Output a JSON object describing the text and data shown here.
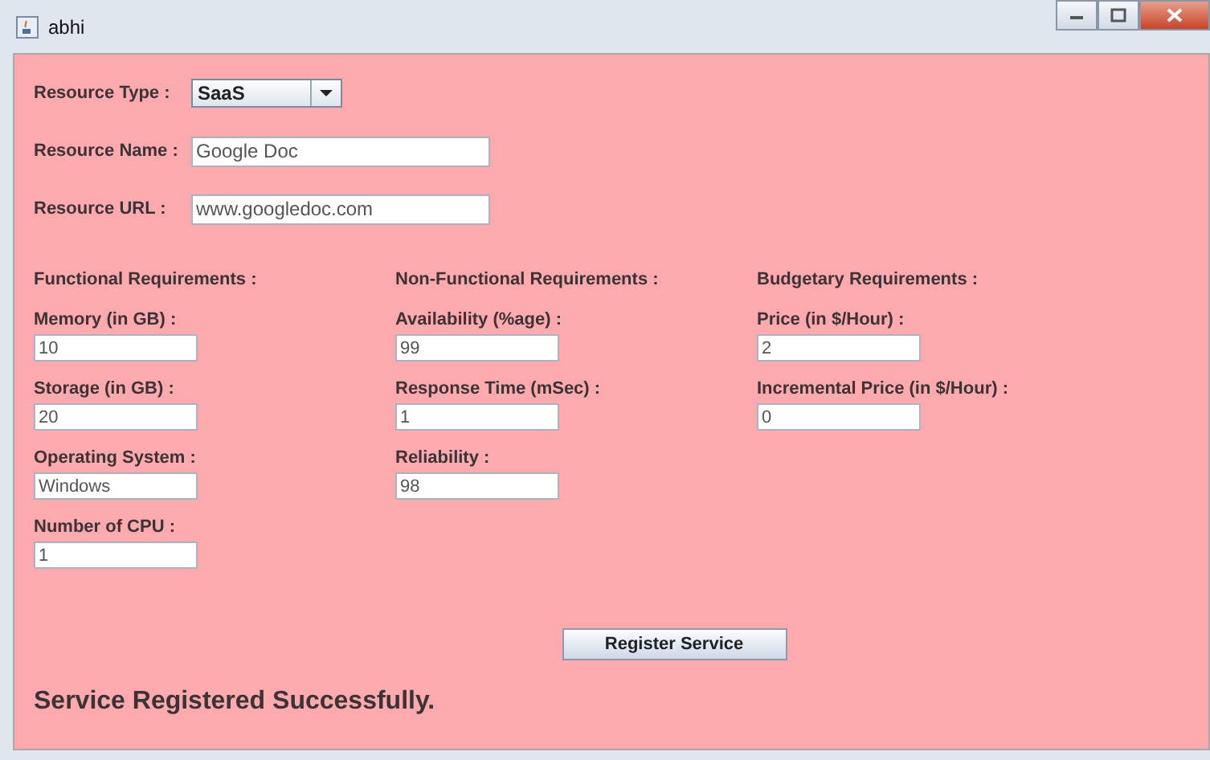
{
  "window": {
    "title": "abhi"
  },
  "top_fields": [
    {
      "kind": "combo",
      "label": "Resource Type :",
      "value": "SaaS"
    },
    {
      "kind": "text",
      "label": "Resource Name :",
      "value": "Google Doc"
    },
    {
      "kind": "text",
      "label": "Resource URL :",
      "value": "www.googledoc.com"
    }
  ],
  "sections": [
    {
      "heading": "Functional Requirements :",
      "fields": [
        {
          "label": "Memory (in GB) :",
          "value": "10"
        },
        {
          "label": "Storage (in GB) :",
          "value": "20"
        },
        {
          "label": "Operating System :",
          "value": "Windows"
        },
        {
          "label": "Number of CPU :",
          "value": "1"
        }
      ]
    },
    {
      "heading": "Non-Functional Requirements :",
      "fields": [
        {
          "label": "Availability (%age) :",
          "value": "99"
        },
        {
          "label": "Response Time (mSec) :",
          "value": "1"
        },
        {
          "label": "Reliability :",
          "value": "98"
        }
      ]
    },
    {
      "heading": "Budgetary Requirements :",
      "fields": [
        {
          "label": "Price (in $/Hour) :",
          "value": "2"
        },
        {
          "label": "Incremental Price (in $/Hour) :",
          "value": "0"
        }
      ]
    }
  ],
  "button": "Register Service",
  "message": "Service Registered Successfully."
}
